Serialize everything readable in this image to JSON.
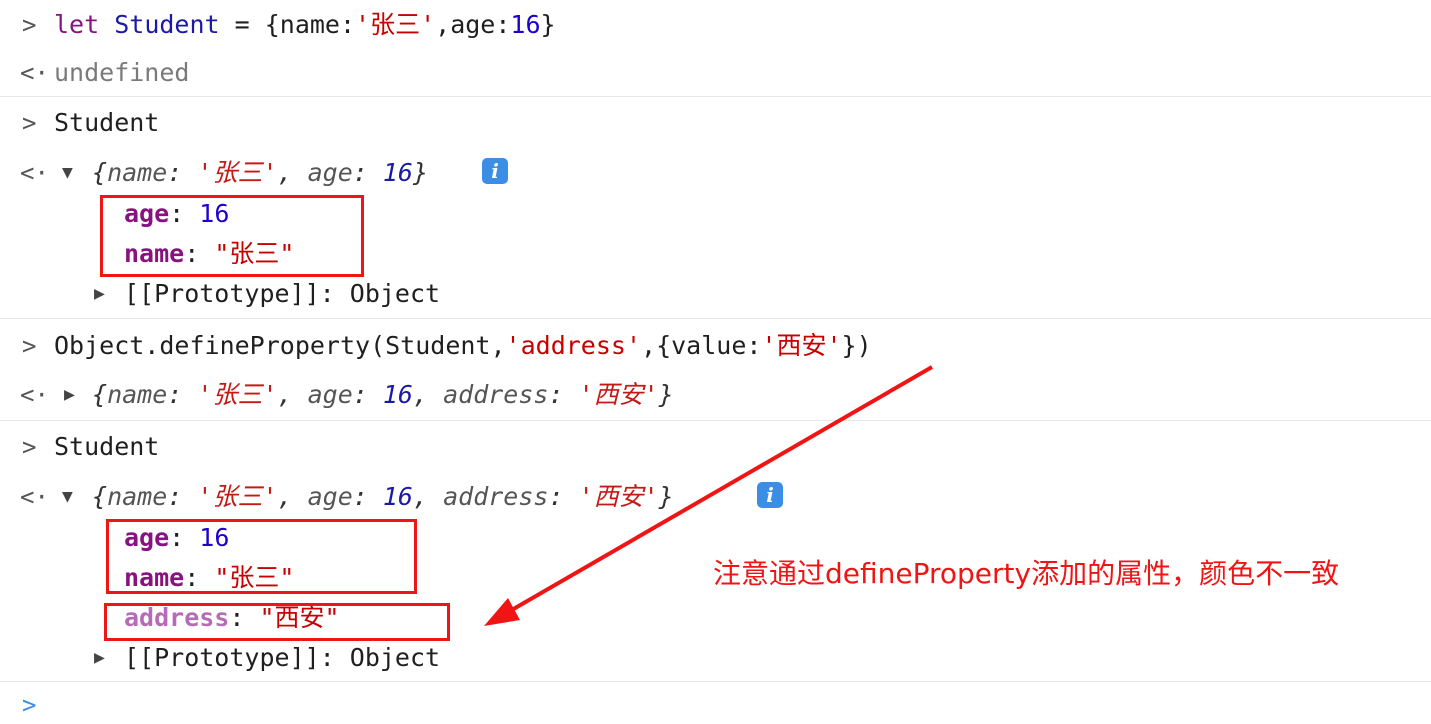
{
  "console": {
    "entry1": {
      "input": {
        "kw": "let",
        "name": "Student",
        "eq": " = {name:",
        "str": "'张三'",
        "rest": ",age:",
        "num": "16",
        "close": "}"
      },
      "result": "undefined"
    },
    "entry2": {
      "input": "Student",
      "preview": {
        "open": "{",
        "k1": "name",
        "c1": ": ",
        "v1": "'张三'",
        "sep1": ", ",
        "k2": "age",
        "c2": ": ",
        "v2": "16",
        "close": "}"
      },
      "props": [
        {
          "key": "age",
          "colon": ": ",
          "value": "16"
        },
        {
          "key": "name",
          "colon": ": ",
          "value": "\"张三\""
        }
      ],
      "prototype": "[[Prototype]]: Object"
    },
    "entry3": {
      "input": {
        "a": "Object.defineProperty(Student,",
        "str1": "'address'",
        "b": ",{value:",
        "str2": "'西安'",
        "c": "})"
      },
      "preview": {
        "open": "{",
        "k1": "name",
        "c1": ": ",
        "v1": "'张三'",
        "sep1": ", ",
        "k2": "age",
        "c2": ": ",
        "v2": "16",
        "sep2": ", ",
        "k3": "address",
        "c3": ": ",
        "v3": "'西安'",
        "close": "}"
      }
    },
    "entry4": {
      "input": "Student",
      "preview": {
        "open": "{",
        "k1": "name",
        "c1": ": ",
        "v1": "'张三'",
        "sep1": ", ",
        "k2": "age",
        "c2": ": ",
        "v2": "16",
        "sep2": ", ",
        "k3": "address",
        "c3": ": ",
        "v3": "'西安'",
        "close": "}"
      },
      "props": [
        {
          "key": "age",
          "colon": ": ",
          "value": "16"
        },
        {
          "key": "name",
          "colon": ": ",
          "value": "\"张三\""
        },
        {
          "key": "address",
          "colon": ": ",
          "value": "\"西安\""
        }
      ],
      "prototype": "[[Prototype]]: Object"
    }
  },
  "annotation": "注意通过defineProperty添加的属性，颜色不一致",
  "icons": {
    "prompt": "chevron-right-icon",
    "result": "return-arrow-icon",
    "info": "info-icon",
    "expand": "triangle-icon"
  },
  "colors": {
    "annotation": "#f01414",
    "own_key": "#881280",
    "defined_key": "#b56bb5",
    "info": "#3a8ee6"
  }
}
